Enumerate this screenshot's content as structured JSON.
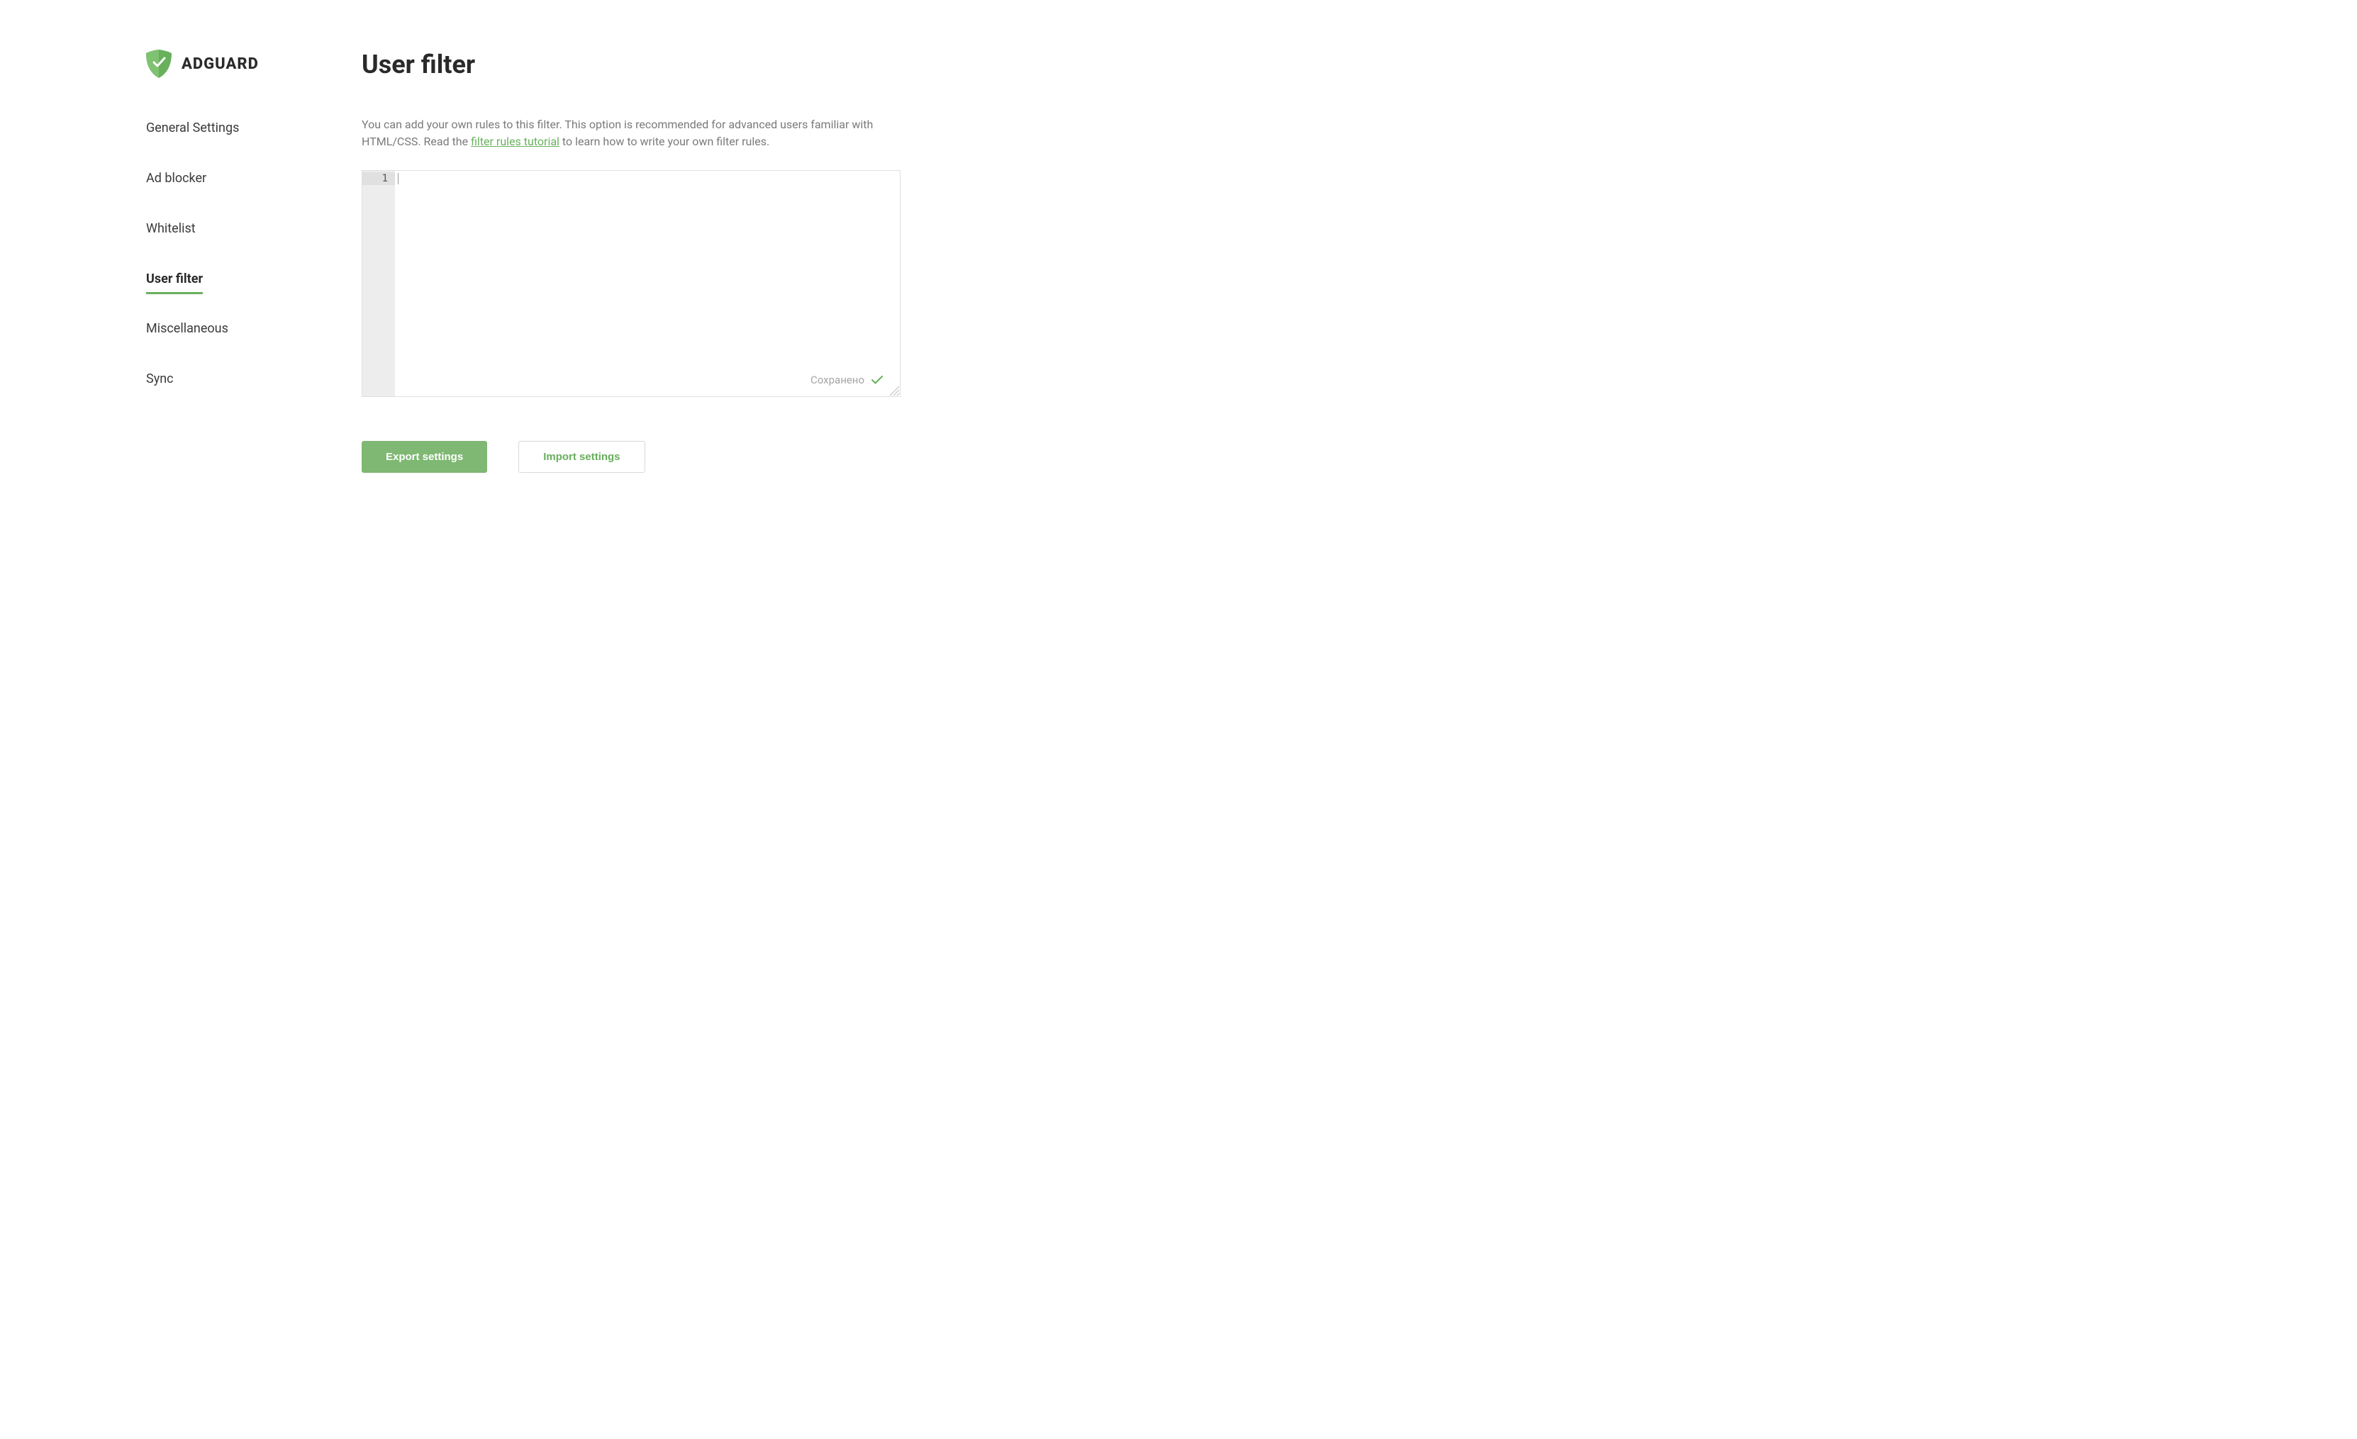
{
  "brand": {
    "name": "ADGUARD"
  },
  "sidebar": {
    "items": [
      {
        "label": "General Settings",
        "active": false
      },
      {
        "label": "Ad blocker",
        "active": false
      },
      {
        "label": "Whitelist",
        "active": false
      },
      {
        "label": "User filter",
        "active": true
      },
      {
        "label": "Miscellaneous",
        "active": false
      },
      {
        "label": "Sync",
        "active": false
      }
    ]
  },
  "page": {
    "title": "User filter",
    "description_before": "You can add your own rules to this filter. This option is recommended for advanced users familiar with HTML/CSS. Read the ",
    "description_link": "filter rules tutorial",
    "description_after": " to learn how to write your own filter rules."
  },
  "editor": {
    "line_number": "1",
    "content": "",
    "saved_label": "Сохранено"
  },
  "buttons": {
    "export": "Export settings",
    "import": "Import settings"
  },
  "colors": {
    "accent": "#68b05c",
    "primary_button": "#7eb872"
  }
}
